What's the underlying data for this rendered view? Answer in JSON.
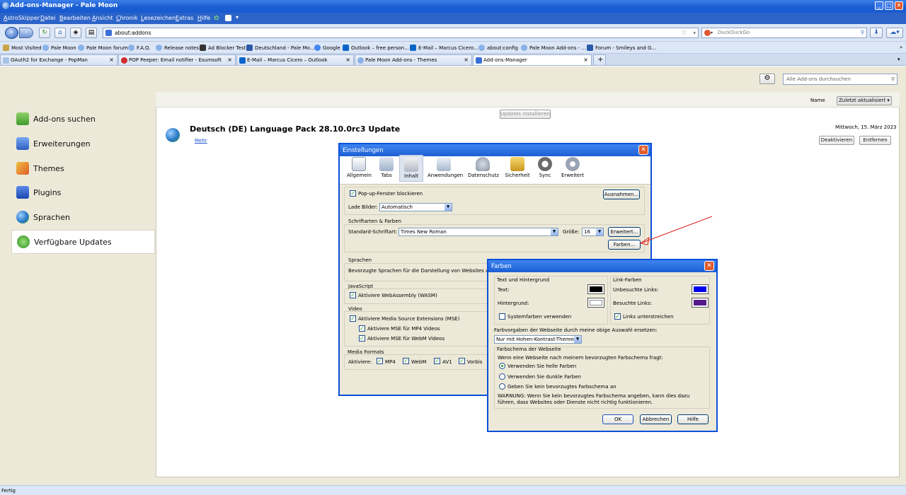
{
  "window": {
    "title": "Add-ons-Manager - Pale Moon"
  },
  "menu": [
    "AstroSkipper",
    "Datei",
    "Bearbeiten",
    "Ansicht",
    "Chronik",
    "Lesezeichen",
    "Extras",
    "Hilfe"
  ],
  "nav": {
    "url": "about:addons",
    "search_placeholder": "DuckDuckGo"
  },
  "bookmarks": [
    "Most Visited",
    "Pale Moon",
    "Pale Moon forum",
    "F.A.Q.",
    "Release notes",
    "Ad Blocker Test",
    "Deutschland - Pale Mo...",
    "Google",
    "Outlook – free person...",
    "E-Mail – Marcus Cicero...",
    "about:config",
    "Pale Moon Add-ons - ...",
    "Forum - Smileys and G..."
  ],
  "tabs": [
    {
      "label": "OAuth2 for Exchange - PopMan"
    },
    {
      "label": "POP Peeper: Email notifier - Esumsoft"
    },
    {
      "label": "E-Mail – Marcus Cicero – Outlook"
    },
    {
      "label": "Pale Moon Add-ons - Themes"
    },
    {
      "label": "Add-ons-Manager"
    }
  ],
  "addons": {
    "search_placeholder": "Alle Add-ons durchsuchen",
    "categories": [
      "Add-ons suchen",
      "Erweiterungen",
      "Themes",
      "Plugins",
      "Sprachen",
      "Verfügbare Updates"
    ],
    "sort_name": "Name",
    "sort_updated": "Zuletzt aktualisiert",
    "install_updates": "Updates installieren",
    "item": {
      "title": "Deutsch (DE) Language Pack  28.10.0rc3  Update",
      "more": "Mehr",
      "date": "Mittwoch, 15. März 2023",
      "disable": "Deaktivieren",
      "remove": "Entfernen"
    }
  },
  "settings": {
    "title": "Einstellungen",
    "toolbar": [
      "Allgemein",
      "Tabs",
      "Inhalt",
      "Anwendungen",
      "Datenschutz",
      "Sicherheit",
      "Sync",
      "Erweitert"
    ],
    "popup_block": "Pop-up-Fenster blockieren",
    "exceptions": "Ausnahmen...",
    "load_images_label": "Lade Bilder:",
    "load_images_value": "Automatisch",
    "fonts_group": "Schriftarten & Farben",
    "default_font_label": "Standard-Schriftart:",
    "default_font_value": "Times New Roman",
    "size_label": "Größe:",
    "size_value": "16",
    "advanced": "Erweitert...",
    "colors": "Farben...",
    "languages_group": "Sprachen",
    "languages_text": "Bevorzugte Sprachen für die Darstellung von Websites wähle",
    "js_group": "JavaScript",
    "wasm": "Aktiviere WebAssembly (WASM)",
    "video_group": "Video",
    "mse": "Aktiviere Media Source Extensions (MSE)",
    "mse_mp4": "Aktiviere MSE für MP4 Videos",
    "mse_webm": "Aktiviere MSE für WebM Videos",
    "media_group": "Media Formats",
    "activate_label": "Aktiviere:",
    "formats": [
      "MP4",
      "WebM",
      "AV1",
      "Vorbis"
    ]
  },
  "colors_dialog": {
    "title": "Farben",
    "text_bg_group": "Text und Hintergrund",
    "text_label": "Text:",
    "background_label": "Hintergrund:",
    "system_colors": "Systemfarben verwenden",
    "link_group": "Link-Farben",
    "unvisited_label": "Unbesuchte Links:",
    "visited_label": "Besuchte Links:",
    "underline": "Links unterstreichen",
    "override_label": "Farbvorgaben der Webseite durch meine obige Auswahl ersetzen:",
    "override_value": "Nur mit Hohen-Kontrast-Themen",
    "scheme_group": "Farbschema der Webseite",
    "scheme_question": "Wenn eine Webseite nach meinem bevorzugten Farbschema fragt:",
    "scheme_light": "Verwenden Sie helle Farben",
    "scheme_dark": "Verwenden Sie dunkle Farben",
    "scheme_none": "Geben Sie kein bevorzugtes Farbschema an",
    "warning": "WARNUNG: Wenn Sie kein bevorzugtes Farbschema angeben, kann dies dazu führen, dass Websites oder Dienste nicht richtig funktionieren.",
    "ok": "OK",
    "cancel": "Abbrechen",
    "help": "Hilfe",
    "colors": {
      "text": "#000000",
      "background": "#ffffff",
      "unvisited": "#0000ee",
      "visited": "#551a8b"
    }
  },
  "status": "Fertig"
}
